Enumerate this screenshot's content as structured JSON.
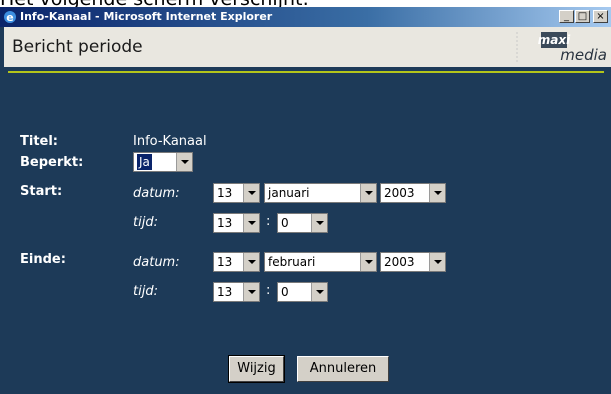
{
  "caption": "Het volgende scherm verschijnt:",
  "window": {
    "title": "Info-Kanaal - Microsoft Internet Explorer",
    "controls": {
      "minimize": "_",
      "maximize": "□",
      "close": "×"
    }
  },
  "header": {
    "title": "Bericht periode",
    "logo": {
      "line1": "maxi",
      "line2": "media"
    }
  },
  "form": {
    "titel": {
      "label": "Titel:",
      "value": "Info-Kanaal"
    },
    "beperkt": {
      "label": "Beperkt:",
      "value": "Ja"
    },
    "start": {
      "label": "Start:",
      "datum_label": "datum:",
      "tijd_label": "tijd:",
      "day": "13",
      "month": "januari",
      "year": "2003",
      "hour": "13",
      "minute": "0"
    },
    "einde": {
      "label": "Einde:",
      "datum_label": "datum:",
      "tijd_label": "tijd:",
      "day": "13",
      "month": "februari",
      "year": "2003",
      "hour": "13",
      "minute": "0"
    },
    "colon": ":"
  },
  "buttons": {
    "wijzig": "Wijzig",
    "annuleren": "Annuleren"
  },
  "colors": {
    "background": "#1d3a58",
    "accent_line": "#b3c41a",
    "titlebar": "#0a246a"
  },
  "icons": {
    "app": "internet-explorer-icon",
    "dropdown": "chevron-down-icon"
  }
}
